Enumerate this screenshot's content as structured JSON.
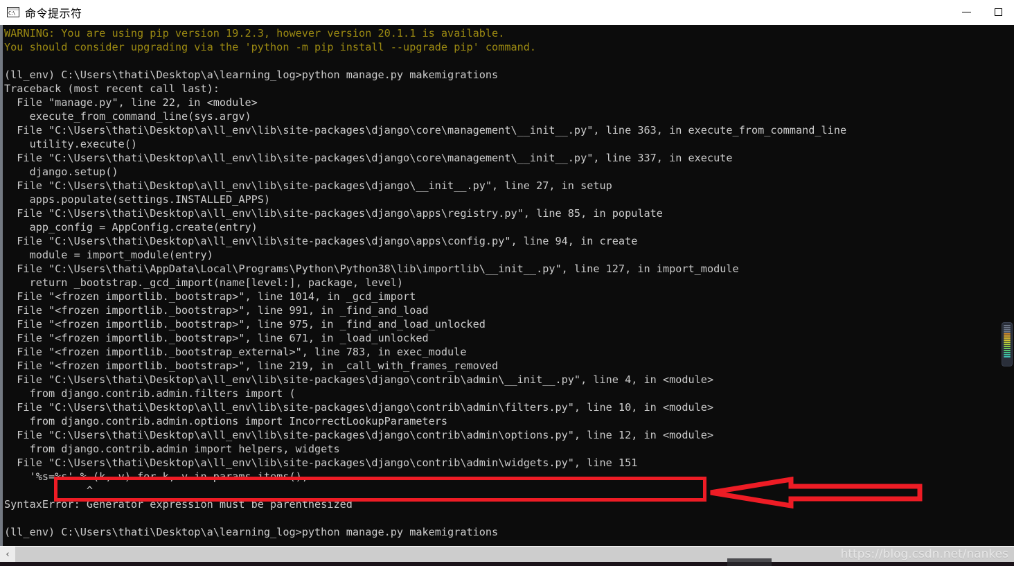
{
  "window": {
    "title": "命令提示符",
    "icon": "console-icon",
    "controls": {
      "minimize": "minimize-button",
      "maximize": "maximize-button"
    }
  },
  "terminal": {
    "background": "#0c0c0c",
    "text_color": "#cccccc",
    "warning_color": "#9c8a12",
    "lines": [
      {
        "id": 0,
        "style": "warn",
        "text": "WARNING: You are using pip version 19.2.3, however version 20.1.1 is available."
      },
      {
        "id": 1,
        "style": "warn",
        "text": "You should consider upgrading via the 'python -m pip install --upgrade pip' command."
      },
      {
        "id": 2,
        "style": "gray",
        "text": ""
      },
      {
        "id": 3,
        "style": "gray",
        "text": "(ll_env) C:\\Users\\thati\\Desktop\\a\\learning_log>python manage.py makemigrations"
      },
      {
        "id": 4,
        "style": "gray",
        "text": "Traceback (most recent call last):"
      },
      {
        "id": 5,
        "style": "gray",
        "text": "  File \"manage.py\", line 22, in <module>"
      },
      {
        "id": 6,
        "style": "gray",
        "text": "    execute_from_command_line(sys.argv)"
      },
      {
        "id": 7,
        "style": "gray",
        "text": "  File \"C:\\Users\\thati\\Desktop\\a\\ll_env\\lib\\site-packages\\django\\core\\management\\__init__.py\", line 363, in execute_from_command_line"
      },
      {
        "id": 8,
        "style": "gray",
        "text": "    utility.execute()"
      },
      {
        "id": 9,
        "style": "gray",
        "text": "  File \"C:\\Users\\thati\\Desktop\\a\\ll_env\\lib\\site-packages\\django\\core\\management\\__init__.py\", line 337, in execute"
      },
      {
        "id": 10,
        "style": "gray",
        "text": "    django.setup()"
      },
      {
        "id": 11,
        "style": "gray",
        "text": "  File \"C:\\Users\\thati\\Desktop\\a\\ll_env\\lib\\site-packages\\django\\__init__.py\", line 27, in setup"
      },
      {
        "id": 12,
        "style": "gray",
        "text": "    apps.populate(settings.INSTALLED_APPS)"
      },
      {
        "id": 13,
        "style": "gray",
        "text": "  File \"C:\\Users\\thati\\Desktop\\a\\ll_env\\lib\\site-packages\\django\\apps\\registry.py\", line 85, in populate"
      },
      {
        "id": 14,
        "style": "gray",
        "text": "    app_config = AppConfig.create(entry)"
      },
      {
        "id": 15,
        "style": "gray",
        "text": "  File \"C:\\Users\\thati\\Desktop\\a\\ll_env\\lib\\site-packages\\django\\apps\\config.py\", line 94, in create"
      },
      {
        "id": 16,
        "style": "gray",
        "text": "    module = import_module(entry)"
      },
      {
        "id": 17,
        "style": "gray",
        "text": "  File \"C:\\Users\\thati\\AppData\\Local\\Programs\\Python\\Python38\\lib\\importlib\\__init__.py\", line 127, in import_module"
      },
      {
        "id": 18,
        "style": "gray",
        "text": "    return _bootstrap._gcd_import(name[level:], package, level)"
      },
      {
        "id": 19,
        "style": "gray",
        "text": "  File \"<frozen importlib._bootstrap>\", line 1014, in _gcd_import"
      },
      {
        "id": 20,
        "style": "gray",
        "text": "  File \"<frozen importlib._bootstrap>\", line 991, in _find_and_load"
      },
      {
        "id": 21,
        "style": "gray",
        "text": "  File \"<frozen importlib._bootstrap>\", line 975, in _find_and_load_unlocked"
      },
      {
        "id": 22,
        "style": "gray",
        "text": "  File \"<frozen importlib._bootstrap>\", line 671, in _load_unlocked"
      },
      {
        "id": 23,
        "style": "gray",
        "text": "  File \"<frozen importlib._bootstrap_external>\", line 783, in exec_module"
      },
      {
        "id": 24,
        "style": "gray",
        "text": "  File \"<frozen importlib._bootstrap>\", line 219, in _call_with_frames_removed"
      },
      {
        "id": 25,
        "style": "gray",
        "text": "  File \"C:\\Users\\thati\\Desktop\\a\\ll_env\\lib\\site-packages\\django\\contrib\\admin\\__init__.py\", line 4, in <module>"
      },
      {
        "id": 26,
        "style": "gray",
        "text": "    from django.contrib.admin.filters import ("
      },
      {
        "id": 27,
        "style": "gray",
        "text": "  File \"C:\\Users\\thati\\Desktop\\a\\ll_env\\lib\\site-packages\\django\\contrib\\admin\\filters.py\", line 10, in <module>"
      },
      {
        "id": 28,
        "style": "gray",
        "text": "    from django.contrib.admin.options import IncorrectLookupParameters"
      },
      {
        "id": 29,
        "style": "gray",
        "text": "  File \"C:\\Users\\thati\\Desktop\\a\\ll_env\\lib\\site-packages\\django\\contrib\\admin\\options.py\", line 12, in <module>"
      },
      {
        "id": 30,
        "style": "gray",
        "text": "    from django.contrib.admin import helpers, widgets"
      },
      {
        "id": 31,
        "style": "gray",
        "text": "  File \"C:\\Users\\thati\\Desktop\\a\\ll_env\\lib\\site-packages\\django\\contrib\\admin\\widgets.py\", line 151"
      },
      {
        "id": 32,
        "style": "gray",
        "text": "    '%s=%s' % (k, v) for k, v in params.items(),"
      },
      {
        "id": 33,
        "style": "gray",
        "text": "             ^"
      },
      {
        "id": 34,
        "style": "gray",
        "text": "SyntaxError: Generator expression must be parenthesized"
      },
      {
        "id": 35,
        "style": "gray",
        "text": ""
      },
      {
        "id": 36,
        "style": "gray",
        "text": "(ll_env) C:\\Users\\thati\\Desktop\\a\\learning_log>python manage.py makemigrations"
      }
    ]
  },
  "annotations": {
    "color": "#ee1c25",
    "highlight_box": {
      "name": "error-highlight-box",
      "target_text": "C:\\Users\\thati\\Desktop\\a\\ll_env\\lib\\site-packages\\django\\contrib\\admin\\widgets.py\", line 151"
    },
    "arrow": {
      "name": "pointer-arrow",
      "direction": "left"
    }
  },
  "minimap": {
    "rows": [
      "#6b7484",
      "#6b7484",
      "#6b7484",
      "#6b7484",
      "#d08a2a",
      "#d9a52e",
      "#d9b52e",
      "#cfc132",
      "#bdc936",
      "#a9c93c",
      "#8ec845",
      "#6ec657",
      "#56c472",
      "#45c08c",
      "#3fbda0",
      "#3fbdb0"
    ]
  },
  "scrollbar": {
    "left_arrow": "‹",
    "name": "horizontal-scrollbar"
  },
  "watermark": {
    "text": "https://blog.csdn.net/nankes"
  }
}
